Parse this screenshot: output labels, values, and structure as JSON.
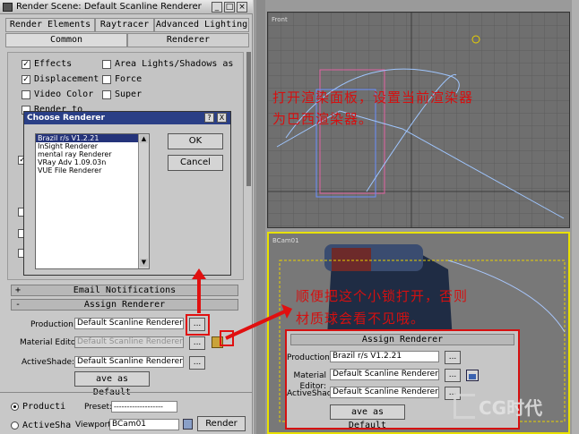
{
  "render_window": {
    "title": "Render Scene: Default Scanline Renderer",
    "tabs_row1": [
      "Render Elements",
      "Raytracer",
      "Advanced Lighting"
    ],
    "tabs_row2": [
      "Common",
      "Renderer"
    ],
    "options_left": [
      {
        "label": "Effects",
        "checked": true
      },
      {
        "label": "Displacement",
        "checked": true
      },
      {
        "label": "Video Color",
        "checked": false
      },
      {
        "label": "Render to",
        "checked": false
      }
    ],
    "options_right": [
      {
        "label": "Area Lights/Shadows as",
        "checked": false
      },
      {
        "label": "Force",
        "checked": false
      },
      {
        "label": "Super",
        "checked": false
      }
    ],
    "rollouts": {
      "email": "Email Notifications",
      "assign": "Assign Renderer",
      "plus": "+",
      "minus": "-"
    },
    "assign": {
      "production_label": "Production:",
      "production_value": "Default Scanline Renderer",
      "material_label": "Material Editor:",
      "material_value": "Default Scanline Renderer",
      "activeshade_label": "ActiveShade:",
      "activeshade_value": "Default Scanline Renderer",
      "ellipsis": "...",
      "save_default": "ave as Default"
    },
    "bottom": {
      "production_radio": "Producti",
      "activeshade_radio": "ActiveSha",
      "preset_label": "Preset:",
      "preset_value": "-------------------",
      "viewport_label": "Viewport:",
      "viewport_value": "BCam01",
      "render_button": "Render"
    }
  },
  "choose_dialog": {
    "title": "Choose Renderer",
    "help": "?",
    "close": "X",
    "renderers": [
      "Brazil r/s V1.2.21",
      "InSight Renderer",
      "mental ray Renderer",
      "VRay Adv 1.09.03n",
      "VUE File Renderer"
    ],
    "selected_index": 0,
    "ok": "OK",
    "cancel": "Cancel"
  },
  "viewports": {
    "front_label": "Front",
    "bcam_label": "BCam01"
  },
  "annotations": {
    "note1_line1": "打开渲染面板，设置当前渲染器",
    "note1_line2": "为巴西渲染器。",
    "note2_line1": "顺便把这个小锁打开，否则",
    "note2_line2": "材质球会看不见哦。"
  },
  "zoom_panel": {
    "title": "Assign Renderer",
    "production_label": "Production:",
    "production_value": "Brazil r/s V1.2.21",
    "material_label": "Material Editor:",
    "material_value": "Default Scanline Renderer",
    "activeshade_label": "ActiveShade:",
    "activeshade_value": "Default Scanline Renderer",
    "ellipsis": "...",
    "save_default": "ave as Default"
  },
  "watermark": {
    "text": "CG时代"
  },
  "colors": {
    "annotation_red": "#d51010",
    "viewport_active": "#e8e000",
    "dialog_title": "#2a3f86"
  }
}
